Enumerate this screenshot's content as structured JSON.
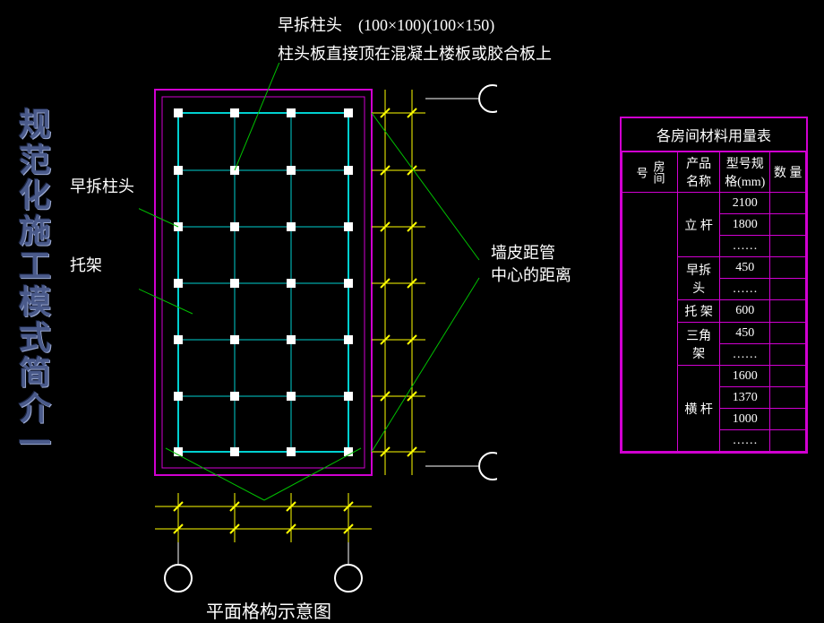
{
  "title_vertical": "规范化施工模式简介一",
  "top_label_line1": "早拆柱头　(100×100)(100×150)",
  "top_label_line2": "柱头板直接顶在混凝土楼板或胶合板上",
  "label_left_1": "早拆柱头",
  "label_left_2": "托架",
  "label_right": "墙皮距管\n中心的距离",
  "caption": "平面格构示意图",
  "table": {
    "title": "各房间材料用量表",
    "head_room": "房间号",
    "head_name": "产品名称",
    "head_spec": "型号规格(mm)",
    "head_qty": "数 量",
    "rows": [
      {
        "name": "立 杆",
        "spec": "2100",
        "qty": ""
      },
      {
        "name": "",
        "spec": "1800",
        "qty": ""
      },
      {
        "name": "",
        "spec": "……",
        "qty": ""
      },
      {
        "name": "早拆头",
        "spec": "450",
        "qty": ""
      },
      {
        "name": "",
        "spec": "……",
        "qty": ""
      },
      {
        "name": "托 架",
        "spec": "600",
        "qty": ""
      },
      {
        "name": "三角架",
        "spec": "450",
        "qty": ""
      },
      {
        "name": "",
        "spec": "……",
        "qty": ""
      },
      {
        "name": "横 杆",
        "spec": "1600",
        "qty": ""
      },
      {
        "name": "",
        "spec": "1370",
        "qty": ""
      },
      {
        "name": "",
        "spec": "1000",
        "qty": ""
      },
      {
        "name": "",
        "spec": "……",
        "qty": ""
      }
    ]
  },
  "chart_data": {
    "type": "table",
    "title": "各房间材料用量表",
    "columns": [
      "房间号",
      "产品名称",
      "型号规格(mm)",
      "数量"
    ],
    "data": [
      [
        "",
        "立杆",
        "2100",
        ""
      ],
      [
        "",
        "立杆",
        "1800",
        ""
      ],
      [
        "",
        "立杆",
        "……",
        ""
      ],
      [
        "",
        "早拆头",
        "450",
        ""
      ],
      [
        "",
        "早拆头",
        "……",
        ""
      ],
      [
        "",
        "托架",
        "600",
        ""
      ],
      [
        "",
        "三角架",
        "450",
        ""
      ],
      [
        "",
        "三角架",
        "……",
        ""
      ],
      [
        "",
        "横杆",
        "1600",
        ""
      ],
      [
        "",
        "横杆",
        "1370",
        ""
      ],
      [
        "",
        "横杆",
        "1000",
        ""
      ],
      [
        "",
        "横杆",
        "……",
        ""
      ]
    ]
  }
}
